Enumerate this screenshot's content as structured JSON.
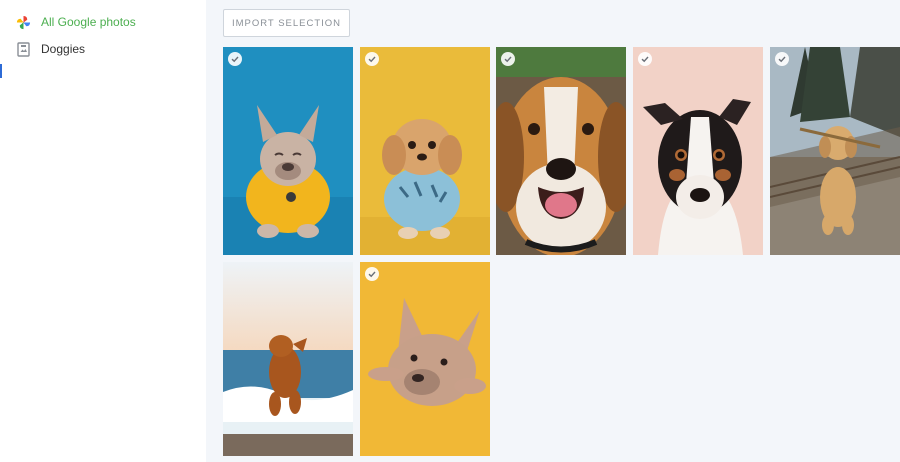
{
  "sidebar": {
    "items": [
      {
        "label": "All Google photos",
        "icon": "google-photos-pinwheel-icon",
        "active": true
      },
      {
        "label": "Doggies",
        "icon": "album-icon",
        "active": false
      }
    ]
  },
  "toolbar": {
    "import_label": "IMPORT SELECTION"
  },
  "colors": {
    "active_text": "#4caf50",
    "main_bg": "#f3f6fa"
  },
  "photos": [
    {
      "subject": "french-bulldog-yellow-shirt",
      "selected": true
    },
    {
      "subject": "shih-tzu-blue-shirt",
      "selected": true
    },
    {
      "subject": "beagle-closeup",
      "selected": true
    },
    {
      "subject": "jack-russell-closeup",
      "selected": true
    },
    {
      "subject": "golden-retriever-stick",
      "selected": true
    },
    {
      "subject": "dog-running-waves",
      "selected": false
    },
    {
      "subject": "french-bulldog-lying",
      "selected": true
    }
  ]
}
